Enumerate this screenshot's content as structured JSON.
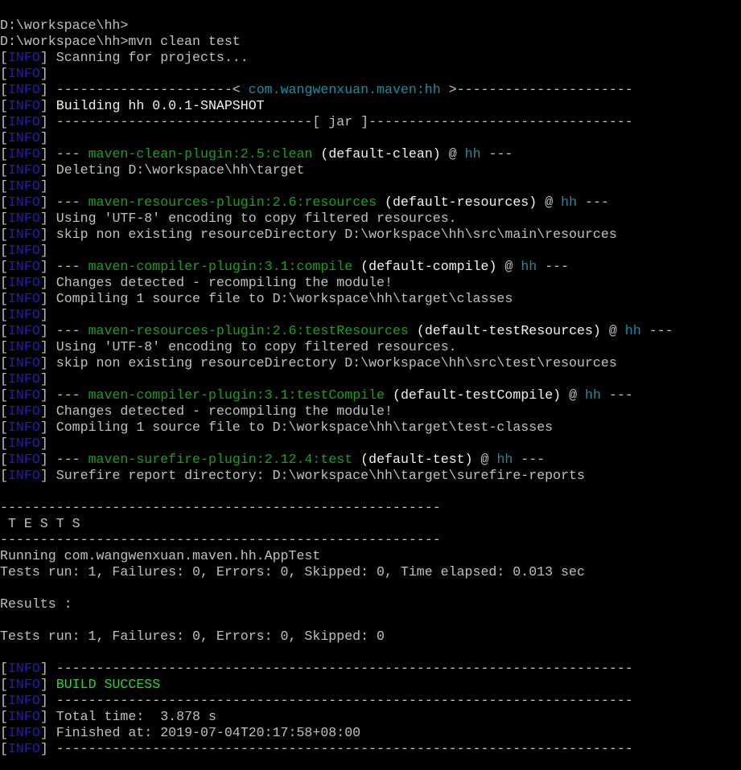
{
  "palette": {
    "background": "#000000",
    "default_text": "#c0c0c0",
    "info_tag": "#1e1eb4",
    "cyan": "#1d8aa6",
    "green": "#18a01c",
    "bright_green": "#22dd22",
    "bright_white": "#f2f2f2"
  },
  "lines": [
    {
      "segments": [
        {
          "text": "D:\\workspace\\hh>",
          "c": "default"
        }
      ]
    },
    {
      "segments": [
        {
          "text": "D:\\workspace\\hh>mvn clean test",
          "c": "default"
        }
      ]
    },
    {
      "info": true,
      "segments": [
        {
          "text": " Scanning for projects...",
          "c": "default"
        }
      ]
    },
    {
      "info": true,
      "segments": []
    },
    {
      "info": true,
      "segments": [
        {
          "text": " ----------------------< ",
          "c": "default"
        },
        {
          "text": "com.wangwenxuan.maven:hh",
          "c": "cyan"
        },
        {
          "text": " >----------------------",
          "c": "default"
        }
      ]
    },
    {
      "info": true,
      "segments": [
        {
          "text": " Building hh 0.0.1-SNAPSHOT",
          "c": "bright"
        }
      ]
    },
    {
      "info": true,
      "segments": [
        {
          "text": " --------------------------------[ jar ]---------------------------------",
          "c": "default"
        }
      ]
    },
    {
      "info": true,
      "segments": []
    },
    {
      "info": true,
      "segments": [
        {
          "text": " --- ",
          "c": "default"
        },
        {
          "text": "maven-clean-plugin:2.5:clean",
          "c": "green"
        },
        {
          "text": " (default-clean)",
          "c": "bright"
        },
        {
          "text": " @ ",
          "c": "default"
        },
        {
          "text": "hh",
          "c": "cyan"
        },
        {
          "text": " ---",
          "c": "default"
        }
      ]
    },
    {
      "info": true,
      "segments": [
        {
          "text": " Deleting D:\\workspace\\hh\\target",
          "c": "default"
        }
      ]
    },
    {
      "info": true,
      "segments": []
    },
    {
      "info": true,
      "segments": [
        {
          "text": " --- ",
          "c": "default"
        },
        {
          "text": "maven-resources-plugin:2.6:resources",
          "c": "green"
        },
        {
          "text": " (default-resources)",
          "c": "bright"
        },
        {
          "text": " @ ",
          "c": "default"
        },
        {
          "text": "hh",
          "c": "cyan"
        },
        {
          "text": " ---",
          "c": "default"
        }
      ]
    },
    {
      "info": true,
      "segments": [
        {
          "text": " Using 'UTF-8' encoding to copy filtered resources.",
          "c": "default"
        }
      ]
    },
    {
      "info": true,
      "segments": [
        {
          "text": " skip non existing resourceDirectory D:\\workspace\\hh\\src\\main\\resources",
          "c": "default"
        }
      ]
    },
    {
      "info": true,
      "segments": []
    },
    {
      "info": true,
      "segments": [
        {
          "text": " --- ",
          "c": "default"
        },
        {
          "text": "maven-compiler-plugin:3.1:compile",
          "c": "green"
        },
        {
          "text": " (default-compile)",
          "c": "bright"
        },
        {
          "text": " @ ",
          "c": "default"
        },
        {
          "text": "hh",
          "c": "cyan"
        },
        {
          "text": " ---",
          "c": "default"
        }
      ]
    },
    {
      "info": true,
      "segments": [
        {
          "text": " Changes detected - recompiling the module!",
          "c": "default"
        }
      ]
    },
    {
      "info": true,
      "segments": [
        {
          "text": " Compiling 1 source file to D:\\workspace\\hh\\target\\classes",
          "c": "default"
        }
      ]
    },
    {
      "info": true,
      "segments": []
    },
    {
      "info": true,
      "segments": [
        {
          "text": " --- ",
          "c": "default"
        },
        {
          "text": "maven-resources-plugin:2.6:testResources",
          "c": "green"
        },
        {
          "text": " (default-testResources)",
          "c": "bright"
        },
        {
          "text": " @ ",
          "c": "default"
        },
        {
          "text": "hh",
          "c": "cyan"
        },
        {
          "text": " ---",
          "c": "default"
        }
      ]
    },
    {
      "info": true,
      "segments": [
        {
          "text": " Using 'UTF-8' encoding to copy filtered resources.",
          "c": "default"
        }
      ]
    },
    {
      "info": true,
      "segments": [
        {
          "text": " skip non existing resourceDirectory D:\\workspace\\hh\\src\\test\\resources",
          "c": "default"
        }
      ]
    },
    {
      "info": true,
      "segments": []
    },
    {
      "info": true,
      "segments": [
        {
          "text": " --- ",
          "c": "default"
        },
        {
          "text": "maven-compiler-plugin:3.1:testCompile",
          "c": "green"
        },
        {
          "text": " (default-testCompile)",
          "c": "bright"
        },
        {
          "text": " @ ",
          "c": "default"
        },
        {
          "text": "hh",
          "c": "cyan"
        },
        {
          "text": " ---",
          "c": "default"
        }
      ]
    },
    {
      "info": true,
      "segments": [
        {
          "text": " Changes detected - recompiling the module!",
          "c": "default"
        }
      ]
    },
    {
      "info": true,
      "segments": [
        {
          "text": " Compiling 1 source file to D:\\workspace\\hh\\target\\test-classes",
          "c": "default"
        }
      ]
    },
    {
      "info": true,
      "segments": []
    },
    {
      "info": true,
      "segments": [
        {
          "text": " --- ",
          "c": "default"
        },
        {
          "text": "maven-surefire-plugin:2.12.4:test",
          "c": "green"
        },
        {
          "text": " (default-test)",
          "c": "bright"
        },
        {
          "text": " @ ",
          "c": "default"
        },
        {
          "text": "hh",
          "c": "cyan"
        },
        {
          "text": " ---",
          "c": "default"
        }
      ]
    },
    {
      "info": true,
      "segments": [
        {
          "text": " Surefire report directory: D:\\workspace\\hh\\target\\surefire-reports",
          "c": "default"
        }
      ]
    },
    {
      "segments": []
    },
    {
      "segments": [
        {
          "text": "-------------------------------------------------------",
          "c": "default"
        }
      ]
    },
    {
      "segments": [
        {
          "text": " T E S T S",
          "c": "default"
        }
      ]
    },
    {
      "segments": [
        {
          "text": "-------------------------------------------------------",
          "c": "default"
        }
      ]
    },
    {
      "segments": [
        {
          "text": "Running com.wangwenxuan.maven.hh.AppTest",
          "c": "default"
        }
      ]
    },
    {
      "segments": [
        {
          "text": "Tests run: 1, Failures: 0, Errors: 0, Skipped: 0, Time elapsed: 0.013 sec",
          "c": "default"
        }
      ]
    },
    {
      "segments": []
    },
    {
      "segments": [
        {
          "text": "Results :",
          "c": "default"
        }
      ]
    },
    {
      "segments": []
    },
    {
      "segments": [
        {
          "text": "Tests run: 1, Failures: 0, Errors: 0, Skipped: 0",
          "c": "default"
        }
      ]
    },
    {
      "segments": []
    },
    {
      "info": true,
      "segments": [
        {
          "text": " ------------------------------------------------------------------------",
          "c": "default"
        }
      ]
    },
    {
      "info": true,
      "segments": [
        {
          "text": " ",
          "c": "default"
        },
        {
          "text": "BUILD SUCCESS",
          "c": "bright-green"
        }
      ]
    },
    {
      "info": true,
      "segments": [
        {
          "text": " ------------------------------------------------------------------------",
          "c": "default"
        }
      ]
    },
    {
      "info": true,
      "segments": [
        {
          "text": " Total time:  3.878 s",
          "c": "default"
        }
      ]
    },
    {
      "info": true,
      "segments": [
        {
          "text": " Finished at: 2019-07-04T20:17:58+08:00",
          "c": "default"
        }
      ]
    },
    {
      "info": true,
      "segments": [
        {
          "text": " ------------------------------------------------------------------------",
          "c": "default"
        }
      ]
    }
  ],
  "info_tag": {
    "open": "[",
    "label": "INFO",
    "close": "]"
  }
}
